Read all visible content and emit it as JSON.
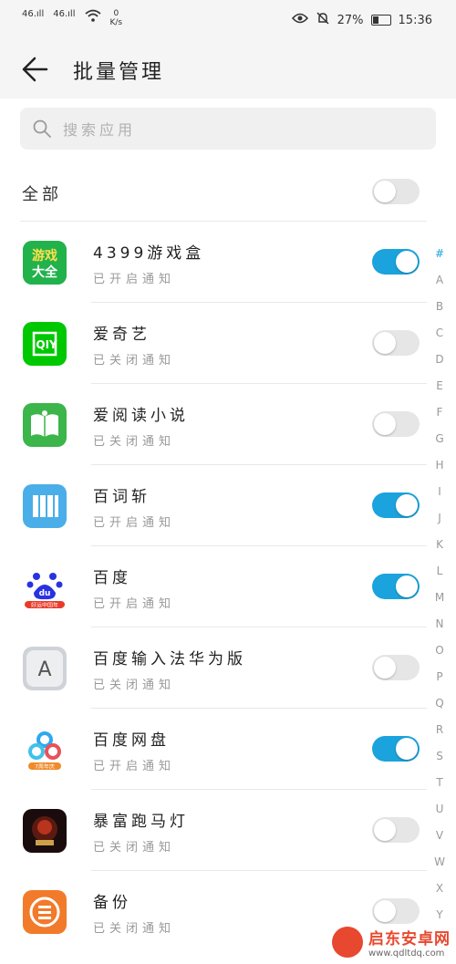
{
  "status_bar": {
    "signal1": "46.ıll",
    "signal2": "46.ıll",
    "net_speed": "0",
    "net_unit": "K/s",
    "battery": "27%",
    "time": "15:36"
  },
  "header": {
    "title": "批量管理"
  },
  "search": {
    "placeholder": "搜索应用"
  },
  "all_row": {
    "label": "全部",
    "enabled": false
  },
  "apps": [
    {
      "name": "4399游戏盒",
      "status": "已开启通知",
      "enabled": true,
      "icon": "game-box-icon"
    },
    {
      "name": "爱奇艺",
      "status": "已关闭通知",
      "enabled": false,
      "icon": "iqiyi-icon"
    },
    {
      "name": "爱阅读小说",
      "status": "已关闭通知",
      "enabled": false,
      "icon": "book-icon"
    },
    {
      "name": "百词斩",
      "status": "已开启通知",
      "enabled": true,
      "icon": "baicizhan-icon"
    },
    {
      "name": "百度",
      "status": "已开启通知",
      "enabled": true,
      "icon": "baidu-paw-icon"
    },
    {
      "name": "百度输入法华为版",
      "status": "已关闭通知",
      "enabled": false,
      "icon": "keyboard-a-icon"
    },
    {
      "name": "百度网盘",
      "status": "已开启通知",
      "enabled": true,
      "icon": "cloud-drive-icon"
    },
    {
      "name": "暴富跑马灯",
      "status": "已关闭通知",
      "enabled": false,
      "icon": "game-art-icon"
    },
    {
      "name": "备份",
      "status": "已关闭通知",
      "enabled": false,
      "icon": "backup-icon"
    }
  ],
  "icon_text": {
    "game_box_line1": "游戏",
    "game_box_line2": "大全",
    "iqiyi": "iQIY",
    "baidu_du": "du",
    "baidu_banner": "好运中国年",
    "keyboard_a": "A",
    "netdisk_banner": "7周年庆"
  },
  "index_letters": [
    "#",
    "A",
    "B",
    "C",
    "D",
    "E",
    "F",
    "G",
    "H",
    "I",
    "J",
    "K",
    "L",
    "M",
    "N",
    "O",
    "P",
    "Q",
    "R",
    "S",
    "T",
    "U",
    "V",
    "W",
    "X",
    "Y"
  ],
  "watermark": {
    "title": "启东安卓网",
    "url": "www.qdltdq.com"
  },
  "colors": {
    "accent": "#1aa3dc",
    "toggle_off": "#e6e6e6"
  }
}
